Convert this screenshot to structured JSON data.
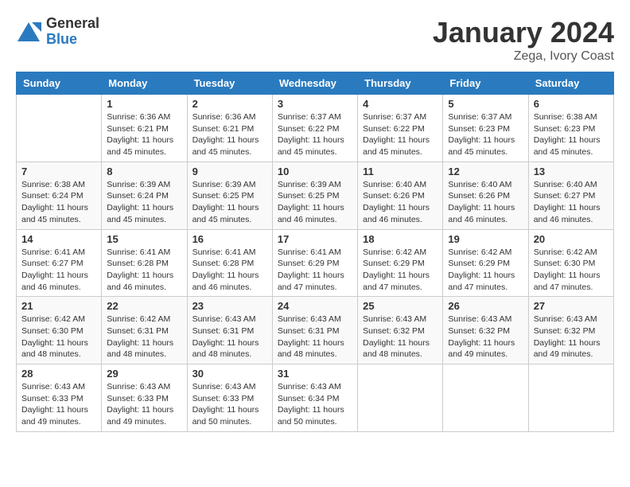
{
  "header": {
    "logo_general": "General",
    "logo_blue": "Blue",
    "title": "January 2024",
    "subtitle": "Zega, Ivory Coast"
  },
  "days_of_week": [
    "Sunday",
    "Monday",
    "Tuesday",
    "Wednesday",
    "Thursday",
    "Friday",
    "Saturday"
  ],
  "weeks": [
    [
      {
        "day": "",
        "sunrise": "",
        "sunset": "",
        "daylight": ""
      },
      {
        "day": "1",
        "sunrise": "Sunrise: 6:36 AM",
        "sunset": "Sunset: 6:21 PM",
        "daylight": "Daylight: 11 hours and 45 minutes."
      },
      {
        "day": "2",
        "sunrise": "Sunrise: 6:36 AM",
        "sunset": "Sunset: 6:21 PM",
        "daylight": "Daylight: 11 hours and 45 minutes."
      },
      {
        "day": "3",
        "sunrise": "Sunrise: 6:37 AM",
        "sunset": "Sunset: 6:22 PM",
        "daylight": "Daylight: 11 hours and 45 minutes."
      },
      {
        "day": "4",
        "sunrise": "Sunrise: 6:37 AM",
        "sunset": "Sunset: 6:22 PM",
        "daylight": "Daylight: 11 hours and 45 minutes."
      },
      {
        "day": "5",
        "sunrise": "Sunrise: 6:37 AM",
        "sunset": "Sunset: 6:23 PM",
        "daylight": "Daylight: 11 hours and 45 minutes."
      },
      {
        "day": "6",
        "sunrise": "Sunrise: 6:38 AM",
        "sunset": "Sunset: 6:23 PM",
        "daylight": "Daylight: 11 hours and 45 minutes."
      }
    ],
    [
      {
        "day": "7",
        "sunrise": "Sunrise: 6:38 AM",
        "sunset": "Sunset: 6:24 PM",
        "daylight": "Daylight: 11 hours and 45 minutes."
      },
      {
        "day": "8",
        "sunrise": "Sunrise: 6:39 AM",
        "sunset": "Sunset: 6:24 PM",
        "daylight": "Daylight: 11 hours and 45 minutes."
      },
      {
        "day": "9",
        "sunrise": "Sunrise: 6:39 AM",
        "sunset": "Sunset: 6:25 PM",
        "daylight": "Daylight: 11 hours and 45 minutes."
      },
      {
        "day": "10",
        "sunrise": "Sunrise: 6:39 AM",
        "sunset": "Sunset: 6:25 PM",
        "daylight": "Daylight: 11 hours and 46 minutes."
      },
      {
        "day": "11",
        "sunrise": "Sunrise: 6:40 AM",
        "sunset": "Sunset: 6:26 PM",
        "daylight": "Daylight: 11 hours and 46 minutes."
      },
      {
        "day": "12",
        "sunrise": "Sunrise: 6:40 AM",
        "sunset": "Sunset: 6:26 PM",
        "daylight": "Daylight: 11 hours and 46 minutes."
      },
      {
        "day": "13",
        "sunrise": "Sunrise: 6:40 AM",
        "sunset": "Sunset: 6:27 PM",
        "daylight": "Daylight: 11 hours and 46 minutes."
      }
    ],
    [
      {
        "day": "14",
        "sunrise": "Sunrise: 6:41 AM",
        "sunset": "Sunset: 6:27 PM",
        "daylight": "Daylight: 11 hours and 46 minutes."
      },
      {
        "day": "15",
        "sunrise": "Sunrise: 6:41 AM",
        "sunset": "Sunset: 6:28 PM",
        "daylight": "Daylight: 11 hours and 46 minutes."
      },
      {
        "day": "16",
        "sunrise": "Sunrise: 6:41 AM",
        "sunset": "Sunset: 6:28 PM",
        "daylight": "Daylight: 11 hours and 46 minutes."
      },
      {
        "day": "17",
        "sunrise": "Sunrise: 6:41 AM",
        "sunset": "Sunset: 6:29 PM",
        "daylight": "Daylight: 11 hours and 47 minutes."
      },
      {
        "day": "18",
        "sunrise": "Sunrise: 6:42 AM",
        "sunset": "Sunset: 6:29 PM",
        "daylight": "Daylight: 11 hours and 47 minutes."
      },
      {
        "day": "19",
        "sunrise": "Sunrise: 6:42 AM",
        "sunset": "Sunset: 6:29 PM",
        "daylight": "Daylight: 11 hours and 47 minutes."
      },
      {
        "day": "20",
        "sunrise": "Sunrise: 6:42 AM",
        "sunset": "Sunset: 6:30 PM",
        "daylight": "Daylight: 11 hours and 47 minutes."
      }
    ],
    [
      {
        "day": "21",
        "sunrise": "Sunrise: 6:42 AM",
        "sunset": "Sunset: 6:30 PM",
        "daylight": "Daylight: 11 hours and 48 minutes."
      },
      {
        "day": "22",
        "sunrise": "Sunrise: 6:42 AM",
        "sunset": "Sunset: 6:31 PM",
        "daylight": "Daylight: 11 hours and 48 minutes."
      },
      {
        "day": "23",
        "sunrise": "Sunrise: 6:43 AM",
        "sunset": "Sunset: 6:31 PM",
        "daylight": "Daylight: 11 hours and 48 minutes."
      },
      {
        "day": "24",
        "sunrise": "Sunrise: 6:43 AM",
        "sunset": "Sunset: 6:31 PM",
        "daylight": "Daylight: 11 hours and 48 minutes."
      },
      {
        "day": "25",
        "sunrise": "Sunrise: 6:43 AM",
        "sunset": "Sunset: 6:32 PM",
        "daylight": "Daylight: 11 hours and 48 minutes."
      },
      {
        "day": "26",
        "sunrise": "Sunrise: 6:43 AM",
        "sunset": "Sunset: 6:32 PM",
        "daylight": "Daylight: 11 hours and 49 minutes."
      },
      {
        "day": "27",
        "sunrise": "Sunrise: 6:43 AM",
        "sunset": "Sunset: 6:32 PM",
        "daylight": "Daylight: 11 hours and 49 minutes."
      }
    ],
    [
      {
        "day": "28",
        "sunrise": "Sunrise: 6:43 AM",
        "sunset": "Sunset: 6:33 PM",
        "daylight": "Daylight: 11 hours and 49 minutes."
      },
      {
        "day": "29",
        "sunrise": "Sunrise: 6:43 AM",
        "sunset": "Sunset: 6:33 PM",
        "daylight": "Daylight: 11 hours and 49 minutes."
      },
      {
        "day": "30",
        "sunrise": "Sunrise: 6:43 AM",
        "sunset": "Sunset: 6:33 PM",
        "daylight": "Daylight: 11 hours and 50 minutes."
      },
      {
        "day": "31",
        "sunrise": "Sunrise: 6:43 AM",
        "sunset": "Sunset: 6:34 PM",
        "daylight": "Daylight: 11 hours and 50 minutes."
      },
      {
        "day": "",
        "sunrise": "",
        "sunset": "",
        "daylight": ""
      },
      {
        "day": "",
        "sunrise": "",
        "sunset": "",
        "daylight": ""
      },
      {
        "day": "",
        "sunrise": "",
        "sunset": "",
        "daylight": ""
      }
    ]
  ]
}
